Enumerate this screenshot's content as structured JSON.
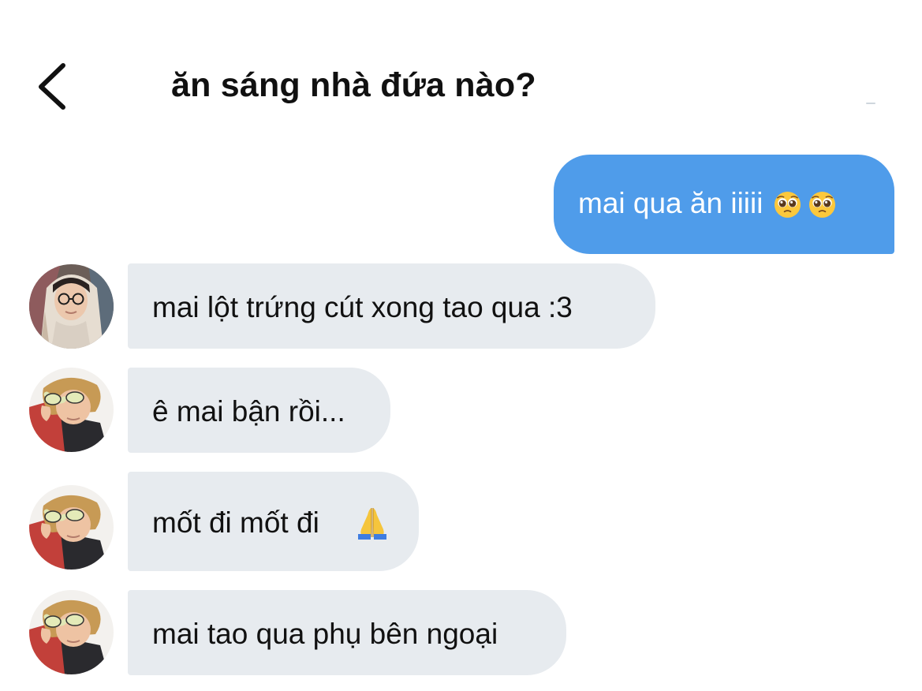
{
  "header": {
    "title": "ăn sáng nhà đứa nào?",
    "back_icon": "chevron-left-icon"
  },
  "colors": {
    "outgoing_bubble": "#4f9cea",
    "incoming_bubble": "#e7ebef",
    "text_dark": "#111111",
    "text_light": "#ffffff"
  },
  "messages": [
    {
      "direction": "outgoing",
      "text": "mai qua ăn iiiii",
      "emojis": [
        "pleading-face-emoji",
        "pleading-face-emoji"
      ]
    },
    {
      "direction": "incoming",
      "avatar": "avatar-hooded-boy",
      "text": "mai lột trứng cút xong tao qua :3"
    },
    {
      "direction": "incoming",
      "avatar": "avatar-sunglasses-boy",
      "text": "ê mai bận rồi..."
    },
    {
      "direction": "incoming",
      "avatar": "avatar-sunglasses-boy",
      "text": "mốt đi mốt đi",
      "emojis": [
        "folded-hands-emoji"
      ]
    },
    {
      "direction": "incoming",
      "avatar": "avatar-sunglasses-boy",
      "text": "mai tao qua phụ bên ngoại"
    }
  ]
}
